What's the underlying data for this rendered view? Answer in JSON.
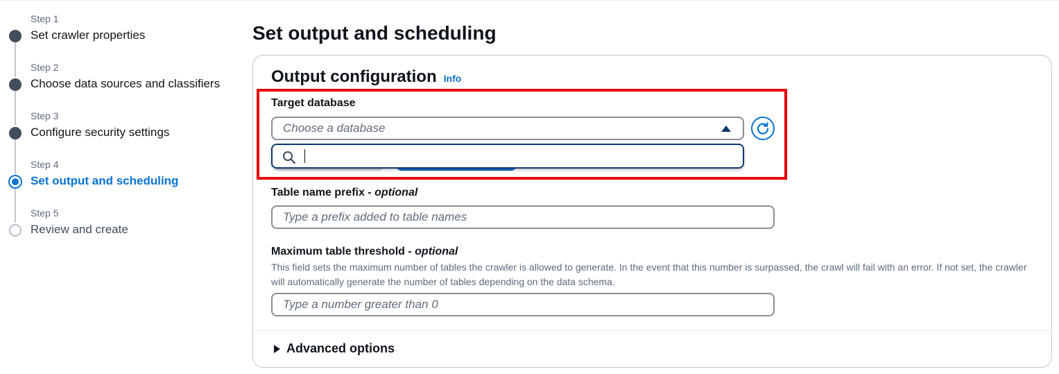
{
  "steps": [
    {
      "number": "Step 1",
      "title": "Set crawler properties",
      "state": "done"
    },
    {
      "number": "Step 2",
      "title": "Choose data sources and classifiers",
      "state": "done"
    },
    {
      "number": "Step 3",
      "title": "Configure security settings",
      "state": "done"
    },
    {
      "number": "Step 4",
      "title": "Set output and scheduling",
      "state": "current"
    },
    {
      "number": "Step 5",
      "title": "Review and create",
      "state": "todo"
    }
  ],
  "page": {
    "title": "Set output and scheduling"
  },
  "output_config": {
    "heading": "Output configuration",
    "info_link": "Info",
    "target_database": {
      "label": "Target database",
      "placeholder": "Choose a database",
      "search_value": ""
    },
    "table_prefix": {
      "label": "Table name prefix",
      "optional": "optional",
      "separator": " - ",
      "placeholder": "Type a prefix added to table names"
    },
    "max_threshold": {
      "label": "Maximum table threshold",
      "optional": "optional",
      "separator": " - ",
      "description": "This field sets the maximum number of tables the crawler is allowed to generate. In the event that this number is surpassed, the crawl will fail with an error. If not set, the crawler will automatically generate the number of tables depending on the data schema.",
      "placeholder": "Type a number greater than 0"
    },
    "advanced_label": "Advanced options"
  },
  "icons": {
    "refresh": "refresh-icon",
    "search": "search-icon",
    "caret": "caret-up-icon",
    "expand": "caret-right-icon"
  },
  "colors": {
    "accent": "#0972d3",
    "highlight": "#e8000b",
    "text": "#0f141a",
    "muted": "#5f6b7a"
  }
}
